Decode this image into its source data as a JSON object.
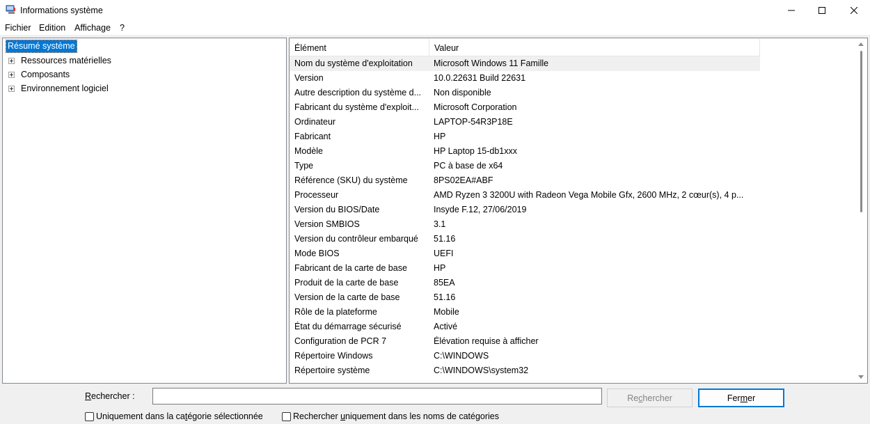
{
  "window": {
    "title": "Informations système"
  },
  "menu": {
    "items": [
      "Fichier",
      "Edition",
      "Affichage",
      "?"
    ]
  },
  "tree": {
    "root": "Résumé système",
    "nodes": [
      "Ressources matérielles",
      "Composants",
      "Environnement logiciel"
    ]
  },
  "list": {
    "headers": [
      "Élément",
      "Valeur"
    ],
    "rows": [
      {
        "el": "Nom du système d'exploitation",
        "val": "Microsoft Windows 11 Famille"
      },
      {
        "el": "Version",
        "val": "10.0.22631 Build 22631"
      },
      {
        "el": "Autre description du système d...",
        "val": "Non disponible"
      },
      {
        "el": "Fabricant du système d'exploit...",
        "val": "Microsoft Corporation"
      },
      {
        "el": "Ordinateur",
        "val": "LAPTOP-54R3P18E"
      },
      {
        "el": "Fabricant",
        "val": "HP"
      },
      {
        "el": "Modèle",
        "val": "HP Laptop 15-db1xxx"
      },
      {
        "el": "Type",
        "val": "PC à base de x64"
      },
      {
        "el": "Référence (SKU) du système",
        "val": "8PS02EA#ABF"
      },
      {
        "el": "Processeur",
        "val": "AMD Ryzen 3 3200U with Radeon Vega Mobile Gfx, 2600 MHz, 2 cœur(s), 4 p..."
      },
      {
        "el": "Version du BIOS/Date",
        "val": "Insyde F.12, 27/06/2019"
      },
      {
        "el": "Version SMBIOS",
        "val": "3.1"
      },
      {
        "el": "Version du contrôleur embarqué",
        "val": "51.16"
      },
      {
        "el": "Mode BIOS",
        "val": "UEFI"
      },
      {
        "el": "Fabricant de la carte de base",
        "val": "HP"
      },
      {
        "el": "Produit de la carte de base",
        "val": "85EA"
      },
      {
        "el": "Version de la carte de base",
        "val": "51.16"
      },
      {
        "el": "Rôle de la plateforme",
        "val": "Mobile"
      },
      {
        "el": "État du démarrage sécurisé",
        "val": "Activé"
      },
      {
        "el": "Configuration de PCR 7",
        "val": "Élévation requise à afficher"
      },
      {
        "el": "Répertoire Windows",
        "val": "C:\\WINDOWS"
      },
      {
        "el": "Répertoire système",
        "val": "C:\\WINDOWS\\system32"
      }
    ]
  },
  "search": {
    "label_u": "R",
    "label_rest": "echercher :",
    "value": "",
    "search_btn_pre": "Re",
    "search_btn_u": "c",
    "search_btn_post": "hercher",
    "close_btn_pre": "Fer",
    "close_btn_u": "m",
    "close_btn_post": "er",
    "check1_pre": "Uniquement dans la ca",
    "check1_u": "t",
    "check1_post": "égorie sélectionnée",
    "check2_pre": "Rechercher ",
    "check2_u": "u",
    "check2_post": "niquement dans les noms de catégories"
  },
  "icons": {
    "app": "system-info-icon",
    "minimize": "minimize-icon",
    "maximize": "maximize-icon",
    "close": "close-icon"
  }
}
